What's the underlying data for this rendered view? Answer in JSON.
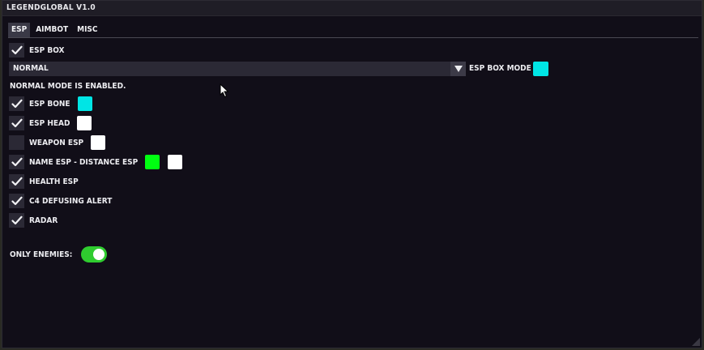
{
  "window": {
    "title": "LEGENDGLOBAL V1.0"
  },
  "tabs": [
    {
      "label": "ESP",
      "active": true
    },
    {
      "label": "AIMBOT",
      "active": false
    },
    {
      "label": "MISC",
      "active": false
    }
  ],
  "esp_box": {
    "label": "ESP BOX",
    "checked": true
  },
  "box_mode": {
    "value": "NORMAL",
    "label": "ESP BOX MODE",
    "color": "#00e5e5",
    "status": "NORMAL MODE IS ENABLED."
  },
  "options": {
    "esp_bone": {
      "label": "ESP BONE",
      "checked": true,
      "color": "#00e5e5"
    },
    "esp_head": {
      "label": "ESP HEAD",
      "checked": true,
      "color": "#ffffff"
    },
    "weapon_esp": {
      "label": "WEAPON ESP",
      "checked": false,
      "color": "#ffffff"
    },
    "name_esp": {
      "label": "NAME ESP - DISTANCE ESP",
      "checked": true,
      "color": "#00ff11",
      "color2": "#ffffff"
    },
    "health_esp": {
      "label": "HEALTH ESP",
      "checked": true
    },
    "c4_alert": {
      "label": "C4 DEFUSING ALERT",
      "checked": true
    },
    "radar": {
      "label": "RADAR",
      "checked": true
    }
  },
  "only_enemies": {
    "label": "ONLY ENEMIES:",
    "on": true,
    "color": "#2fcc2f"
  },
  "colors": {
    "accent_tab": "#3a3946",
    "panel": "#110e18"
  },
  "icons": {
    "check": "check-icon",
    "dropdown": "dropdown-arrow-icon",
    "cursor": "mouse-cursor-icon"
  }
}
